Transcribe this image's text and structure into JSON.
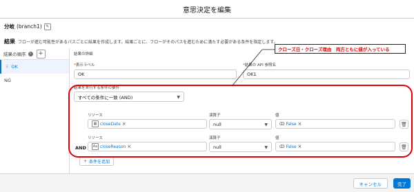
{
  "dialog": {
    "title": "意思決定を編集"
  },
  "branch": {
    "label": "分岐",
    "api_name": "(branch1)"
  },
  "outcomes": {
    "heading": "結果",
    "description": "フローが進む可能性があるパスごとに結果を作成します。結果ごとに、フローがそのパスを進むために満たす必要がある条件を指定します。"
  },
  "sidebar": {
    "header": "結果の順序",
    "items": [
      {
        "label": "OK"
      },
      {
        "label": "NG"
      }
    ]
  },
  "detail": {
    "section_title": "結果の詳細",
    "display_label_label": "表示ラベル",
    "display_label_value": "OK",
    "api_label": "結果の API 参照名",
    "api_value": "OK1",
    "conditions_label": "結果を実行する条件の要件",
    "conditions_select": "すべての条件に一致 (AND)"
  },
  "conditions": {
    "resource_label": "リソース",
    "operator_label": "演算子",
    "value_label": "値",
    "logic_word": "AND",
    "rows": [
      {
        "resource": "closeDate",
        "operator": "null",
        "value": "False"
      },
      {
        "resource": "closeReason",
        "operator": "null",
        "value": "False"
      }
    ],
    "add_button": "条件を追加"
  },
  "annotation": {
    "text": "クローズ日・クローズ理由　両方ともに値が入っている"
  },
  "footer": {
    "cancel": "キャンセル",
    "done": "完了"
  },
  "colors": {
    "brand": "#0176d3",
    "annotation": "#e00000"
  }
}
